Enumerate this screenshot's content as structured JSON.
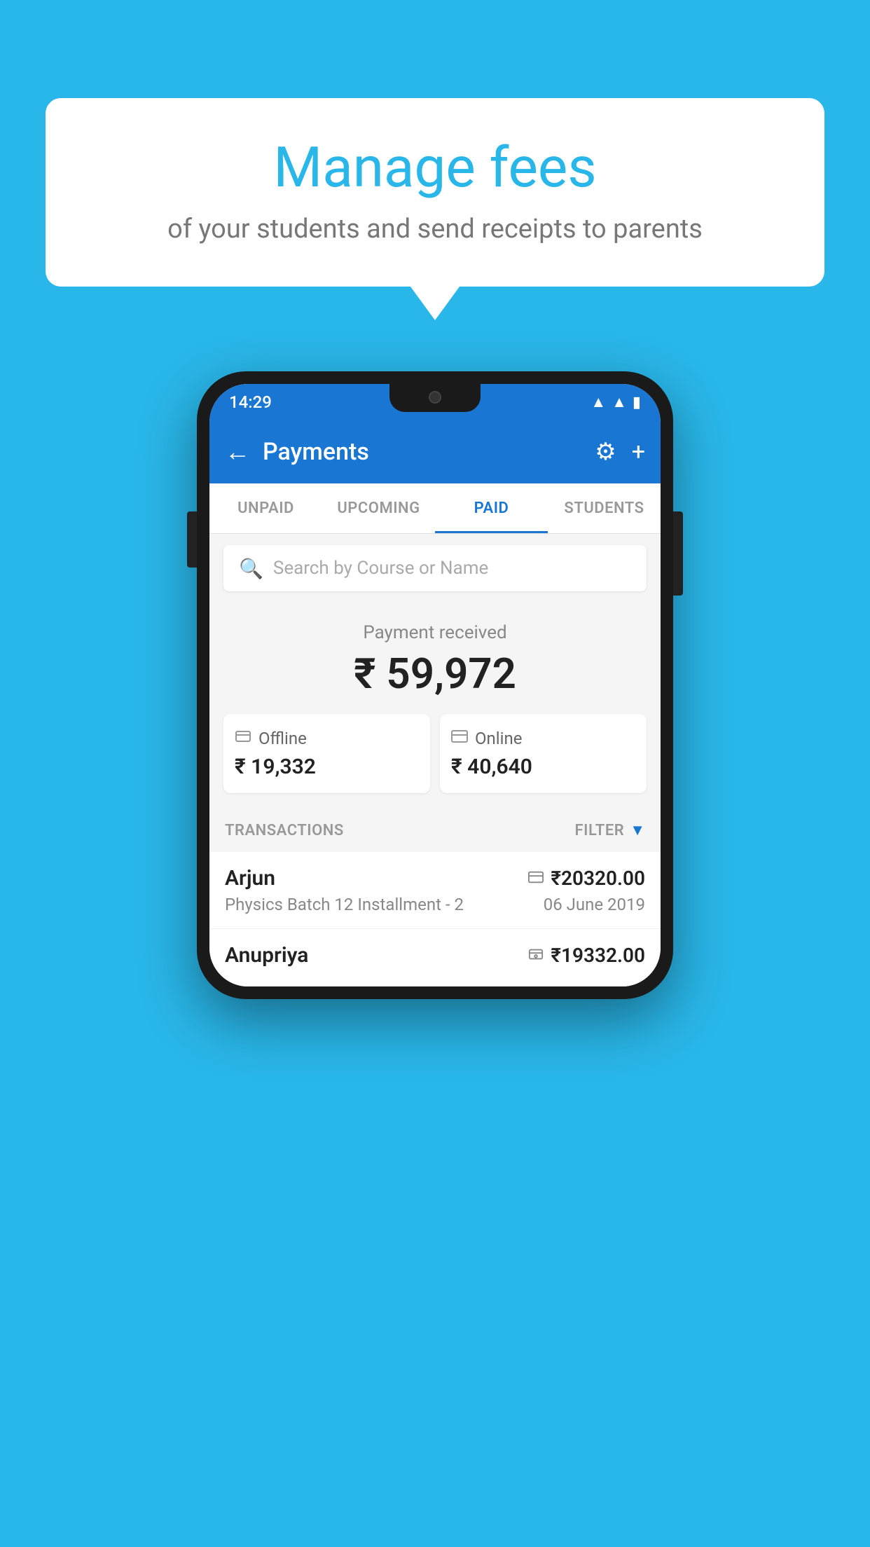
{
  "background_color": "#29b6e8",
  "bubble": {
    "title": "Manage fees",
    "subtitle": "of your students and send receipts to parents"
  },
  "status_bar": {
    "time": "14:29",
    "wifi": "▲",
    "signal": "▲",
    "battery": "▮"
  },
  "app_bar": {
    "title": "Payments",
    "back_label": "←",
    "settings_label": "⚙",
    "add_label": "+"
  },
  "tabs": [
    {
      "label": "UNPAID",
      "active": false
    },
    {
      "label": "UPCOMING",
      "active": false
    },
    {
      "label": "PAID",
      "active": true
    },
    {
      "label": "STUDENTS",
      "active": false
    }
  ],
  "search": {
    "placeholder": "Search by Course or Name"
  },
  "payment_summary": {
    "label": "Payment received",
    "total": "₹ 59,972",
    "offline": {
      "icon": "💳",
      "label": "Offline",
      "amount": "₹ 19,332"
    },
    "online": {
      "icon": "💳",
      "label": "Online",
      "amount": "₹ 40,640"
    }
  },
  "transactions": {
    "header": "TRANSACTIONS",
    "filter": "FILTER",
    "items": [
      {
        "name": "Arjun",
        "type_icon": "💳",
        "amount": "₹20320.00",
        "course": "Physics Batch 12 Installment - 2",
        "date": "06 June 2019"
      },
      {
        "name": "Anupriya",
        "type_icon": "💴",
        "amount": "₹19332.00",
        "course": "",
        "date": ""
      }
    ]
  }
}
